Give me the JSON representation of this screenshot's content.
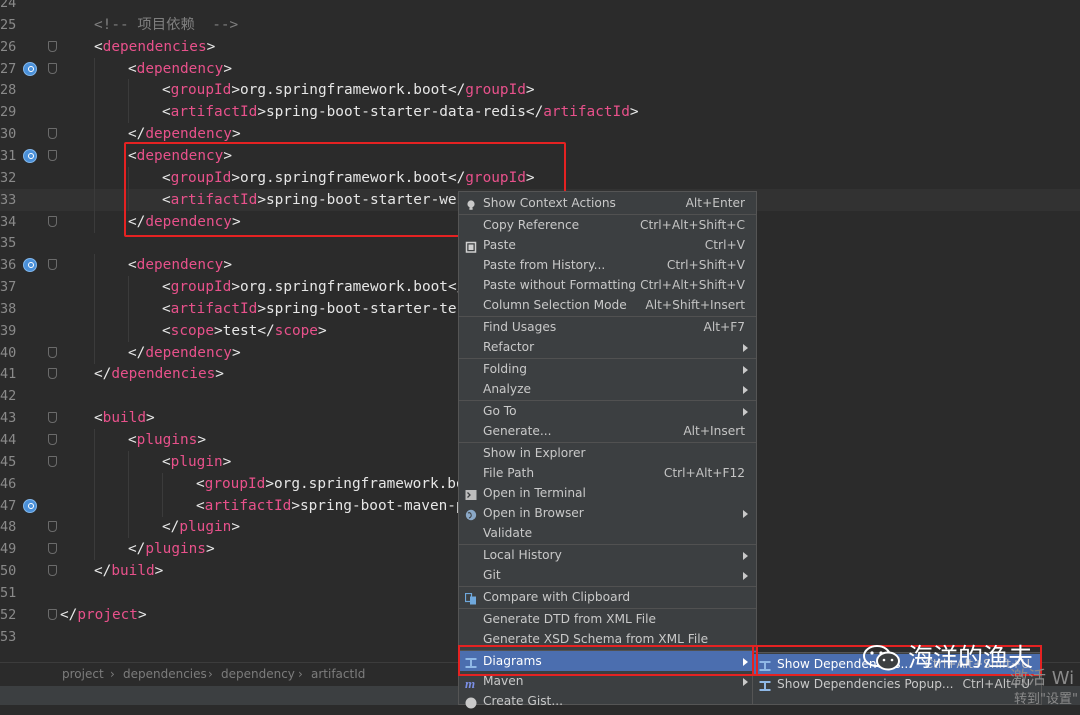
{
  "editor": {
    "lines": [
      {
        "num": "24",
        "parts": []
      },
      {
        "num": "25",
        "parts": [
          {
            "c": "cm",
            "t": "<!-- 项目依赖  -->"
          }
        ],
        "indent": 1
      },
      {
        "num": "26",
        "parts": [
          {
            "c": "br",
            "t": "<"
          },
          {
            "c": "tg",
            "t": "dependencies"
          },
          {
            "c": "br",
            "t": ">"
          }
        ],
        "indent": 1,
        "fold": true
      },
      {
        "num": "27",
        "parts": [
          {
            "c": "br",
            "t": "<"
          },
          {
            "c": "tg",
            "t": "dependency"
          },
          {
            "c": "br",
            "t": ">"
          }
        ],
        "indent": 2,
        "marker": true,
        "fold": true
      },
      {
        "num": "28",
        "parts": [
          {
            "c": "br",
            "t": "<"
          },
          {
            "c": "tg",
            "t": "groupId"
          },
          {
            "c": "br",
            "t": ">"
          },
          {
            "c": "txt",
            "t": "org.springframework.boot"
          },
          {
            "c": "br",
            "t": "</"
          },
          {
            "c": "tg",
            "t": "groupId"
          },
          {
            "c": "br",
            "t": ">"
          }
        ],
        "indent": 3
      },
      {
        "num": "29",
        "parts": [
          {
            "c": "br",
            "t": "<"
          },
          {
            "c": "tg",
            "t": "artifactId"
          },
          {
            "c": "br",
            "t": ">"
          },
          {
            "c": "txt",
            "t": "spring-boot-starter-data-redis"
          },
          {
            "c": "br",
            "t": "</"
          },
          {
            "c": "tg",
            "t": "artifactId"
          },
          {
            "c": "br",
            "t": ">"
          }
        ],
        "indent": 3
      },
      {
        "num": "30",
        "parts": [
          {
            "c": "br",
            "t": "</"
          },
          {
            "c": "tg",
            "t": "dependency"
          },
          {
            "c": "br",
            "t": ">"
          }
        ],
        "indent": 2,
        "fold": true
      },
      {
        "num": "31",
        "parts": [
          {
            "c": "br",
            "t": "<"
          },
          {
            "c": "tg",
            "t": "dependency"
          },
          {
            "c": "br",
            "t": ">"
          }
        ],
        "indent": 2,
        "marker": true,
        "fold": true
      },
      {
        "num": "32",
        "parts": [
          {
            "c": "br",
            "t": "<"
          },
          {
            "c": "tg",
            "t": "groupId"
          },
          {
            "c": "br",
            "t": ">"
          },
          {
            "c": "txt",
            "t": "org.springframework.boot"
          },
          {
            "c": "br",
            "t": "</"
          },
          {
            "c": "tg",
            "t": "groupId"
          },
          {
            "c": "br",
            "t": ">"
          }
        ],
        "indent": 3
      },
      {
        "num": "33",
        "parts": [
          {
            "c": "br",
            "t": "<"
          },
          {
            "c": "tg",
            "t": "artifactId"
          },
          {
            "c": "br",
            "t": ">"
          },
          {
            "c": "txt",
            "t": "spring-boot-starter-web"
          }
        ],
        "indent": 3,
        "current": true
      },
      {
        "num": "34",
        "parts": [
          {
            "c": "br",
            "t": "</"
          },
          {
            "c": "tg",
            "t": "dependency"
          },
          {
            "c": "br",
            "t": ">"
          }
        ],
        "indent": 2,
        "fold": true
      },
      {
        "num": "35",
        "parts": []
      },
      {
        "num": "36",
        "parts": [
          {
            "c": "br",
            "t": "<"
          },
          {
            "c": "tg",
            "t": "dependency"
          },
          {
            "c": "br",
            "t": ">"
          }
        ],
        "indent": 2,
        "marker": true,
        "fold": true
      },
      {
        "num": "37",
        "parts": [
          {
            "c": "br",
            "t": "<"
          },
          {
            "c": "tg",
            "t": "groupId"
          },
          {
            "c": "br",
            "t": ">"
          },
          {
            "c": "txt",
            "t": "org.springframework.boot"
          },
          {
            "c": "br",
            "t": "</"
          }
        ],
        "indent": 3
      },
      {
        "num": "38",
        "parts": [
          {
            "c": "br",
            "t": "<"
          },
          {
            "c": "tg",
            "t": "artifactId"
          },
          {
            "c": "br",
            "t": ">"
          },
          {
            "c": "txt",
            "t": "spring-boot-starter-tes"
          }
        ],
        "indent": 3
      },
      {
        "num": "39",
        "parts": [
          {
            "c": "br",
            "t": "<"
          },
          {
            "c": "tg",
            "t": "scope"
          },
          {
            "c": "br",
            "t": ">"
          },
          {
            "c": "txt",
            "t": "test"
          },
          {
            "c": "br",
            "t": "</"
          },
          {
            "c": "tg",
            "t": "scope"
          },
          {
            "c": "br",
            "t": ">"
          }
        ],
        "indent": 3
      },
      {
        "num": "40",
        "parts": [
          {
            "c": "br",
            "t": "</"
          },
          {
            "c": "tg",
            "t": "dependency"
          },
          {
            "c": "br",
            "t": ">"
          }
        ],
        "indent": 2,
        "fold": true
      },
      {
        "num": "41",
        "parts": [
          {
            "c": "br",
            "t": "</"
          },
          {
            "c": "tg",
            "t": "dependencies"
          },
          {
            "c": "br",
            "t": ">"
          }
        ],
        "indent": 1,
        "fold": true
      },
      {
        "num": "42",
        "parts": []
      },
      {
        "num": "43",
        "parts": [
          {
            "c": "br",
            "t": "<"
          },
          {
            "c": "tg",
            "t": "build"
          },
          {
            "c": "br",
            "t": ">"
          }
        ],
        "indent": 1,
        "fold": true
      },
      {
        "num": "44",
        "parts": [
          {
            "c": "br",
            "t": "<"
          },
          {
            "c": "tg",
            "t": "plugins"
          },
          {
            "c": "br",
            "t": ">"
          }
        ],
        "indent": 2,
        "fold": true
      },
      {
        "num": "45",
        "parts": [
          {
            "c": "br",
            "t": "<"
          },
          {
            "c": "tg",
            "t": "plugin"
          },
          {
            "c": "br",
            "t": ">"
          }
        ],
        "indent": 3,
        "fold": true
      },
      {
        "num": "46",
        "parts": [
          {
            "c": "br",
            "t": "<"
          },
          {
            "c": "tg",
            "t": "groupId"
          },
          {
            "c": "br",
            "t": ">"
          },
          {
            "c": "txt",
            "t": "org.springframework.bo"
          }
        ],
        "indent": 4
      },
      {
        "num": "47",
        "parts": [
          {
            "c": "br",
            "t": "<"
          },
          {
            "c": "tg",
            "t": "artifactId"
          },
          {
            "c": "br",
            "t": ">"
          },
          {
            "c": "txt",
            "t": "spring-boot-maven-p"
          }
        ],
        "indent": 4,
        "marker": true
      },
      {
        "num": "48",
        "parts": [
          {
            "c": "br",
            "t": "</"
          },
          {
            "c": "tg",
            "t": "plugin"
          },
          {
            "c": "br",
            "t": ">"
          }
        ],
        "indent": 3,
        "fold": true
      },
      {
        "num": "49",
        "parts": [
          {
            "c": "br",
            "t": "</"
          },
          {
            "c": "tg",
            "t": "plugins"
          },
          {
            "c": "br",
            "t": ">"
          }
        ],
        "indent": 2,
        "fold": true
      },
      {
        "num": "50",
        "parts": [
          {
            "c": "br",
            "t": "</"
          },
          {
            "c": "tg",
            "t": "build"
          },
          {
            "c": "br",
            "t": ">"
          }
        ],
        "indent": 1,
        "fold": true
      },
      {
        "num": "51",
        "parts": []
      },
      {
        "num": "52",
        "parts": [
          {
            "c": "br",
            "t": "</"
          },
          {
            "c": "tg",
            "t": "project"
          },
          {
            "c": "br",
            "t": ">"
          }
        ],
        "indent": 0,
        "fold": true
      },
      {
        "num": "53",
        "parts": []
      }
    ]
  },
  "breadcrumb": [
    "project",
    "dependencies",
    "dependency",
    "artifactId"
  ],
  "context_menu": {
    "items": [
      {
        "label": "Show Context Actions",
        "shortcut": "Alt+Enter",
        "icon": "bulb-icon"
      },
      {
        "sep": true
      },
      {
        "label": "Copy Reference",
        "shortcut": "Ctrl+Alt+Shift+C"
      },
      {
        "label": "Paste",
        "shortcut": "Ctrl+V",
        "icon": "clipboard-icon"
      },
      {
        "label": "Paste from History...",
        "shortcut": "Ctrl+Shift+V"
      },
      {
        "label": "Paste without Formatting",
        "shortcut": "Ctrl+Alt+Shift+V"
      },
      {
        "label": "Column Selection Mode",
        "shortcut": "Alt+Shift+Insert"
      },
      {
        "sep": true
      },
      {
        "label": "Find Usages",
        "shortcut": "Alt+F7"
      },
      {
        "label": "Refactor",
        "submenu": true
      },
      {
        "sep": true
      },
      {
        "label": "Folding",
        "submenu": true
      },
      {
        "label": "Analyze",
        "submenu": true
      },
      {
        "sep": true
      },
      {
        "label": "Go To",
        "submenu": true
      },
      {
        "label": "Generate...",
        "shortcut": "Alt+Insert"
      },
      {
        "sep": true
      },
      {
        "label": "Show in Explorer"
      },
      {
        "label": "File Path",
        "shortcut": "Ctrl+Alt+F12"
      },
      {
        "label": "Open in Terminal",
        "icon": "terminal-icon"
      },
      {
        "label": "Open in Browser",
        "submenu": true,
        "icon": "globe-icon"
      },
      {
        "label": "Validate"
      },
      {
        "sep": true
      },
      {
        "label": "Local History",
        "submenu": true
      },
      {
        "label": "Git",
        "submenu": true
      },
      {
        "sep": true
      },
      {
        "label": "Compare with Clipboard",
        "icon": "compare-icon"
      },
      {
        "sep": true
      },
      {
        "label": "Generate DTD from XML File"
      },
      {
        "label": "Generate XSD Schema from XML File"
      },
      {
        "sep": true
      },
      {
        "label": "Diagrams",
        "submenu": true,
        "selected": true,
        "icon": "diagram-icon"
      },
      {
        "label": "Maven",
        "submenu": true,
        "icon": "maven-icon"
      },
      {
        "label": "Create Gist...",
        "icon": "github-icon"
      }
    ]
  },
  "submenu": {
    "items": [
      {
        "label": "Show Dependencies...",
        "shortcut": "Ctrl+Alt+Shift+U",
        "selected": true
      },
      {
        "label": "Show Dependencies Popup...",
        "shortcut": "Ctrl+Alt+U"
      }
    ]
  },
  "watermark": {
    "text": "海洋的渔夫"
  },
  "activation": {
    "line1": "激活 Wi",
    "line2": "转到\"设置\""
  }
}
